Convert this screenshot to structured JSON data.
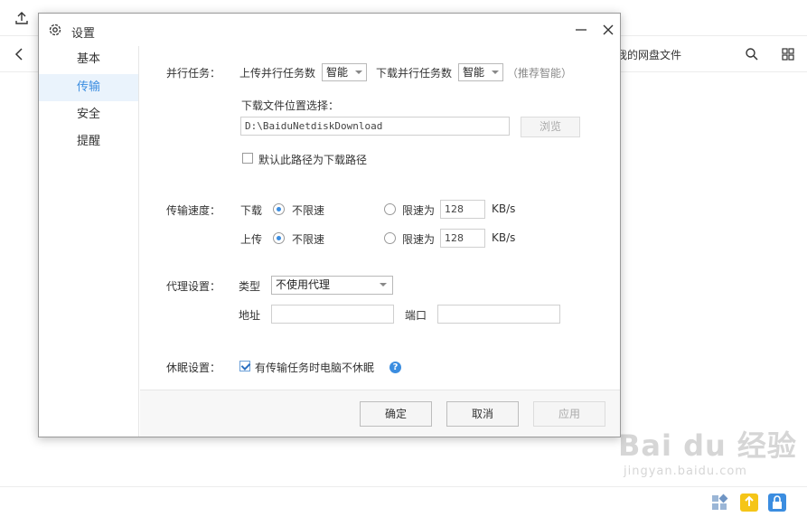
{
  "background": {
    "breadcrumb": "我的网盘文件",
    "watermark_main": "Bai du 经验",
    "watermark_sub": "jingyan.baidu.com",
    "accent": "#3b8de0"
  },
  "dialog": {
    "title": "设置",
    "sidebar": {
      "items": [
        {
          "label": "基本",
          "active": false
        },
        {
          "label": "传输",
          "active": true
        },
        {
          "label": "安全",
          "active": false
        },
        {
          "label": "提醒",
          "active": false
        }
      ]
    },
    "parallel": {
      "title": "并行任务：",
      "upload_label": "上传并行任务数",
      "upload_value": "智能",
      "download_label": "下载并行任务数",
      "download_value": "智能",
      "hint": "（推荐智能）"
    },
    "download_location": {
      "title": "下载文件位置选择：",
      "path": "D:\\BaiduNetdiskDownload",
      "browse_label": "浏览",
      "default_checkbox_label": "默认此路径为下载路径",
      "default_checked": false
    },
    "speed": {
      "title": "传输速度：",
      "download_label": "下载",
      "upload_label": "上传",
      "unlimited_label": "不限速",
      "limit_label": "限速为",
      "download_limit_value": "128",
      "upload_limit_value": "128",
      "unit": "KB/s",
      "download_mode": "unlimited",
      "upload_mode": "unlimited"
    },
    "proxy": {
      "title": "代理设置：",
      "type_label": "类型",
      "type_value": "不使用代理",
      "address_label": "地址",
      "address_value": "",
      "port_label": "端口",
      "port_value": ""
    },
    "sleep": {
      "title": "休眠设置：",
      "checkbox_label": "有传输任务时电脑不休眠",
      "checked": true
    },
    "footer": {
      "ok_label": "确定",
      "cancel_label": "取消",
      "apply_label": "应用"
    }
  }
}
